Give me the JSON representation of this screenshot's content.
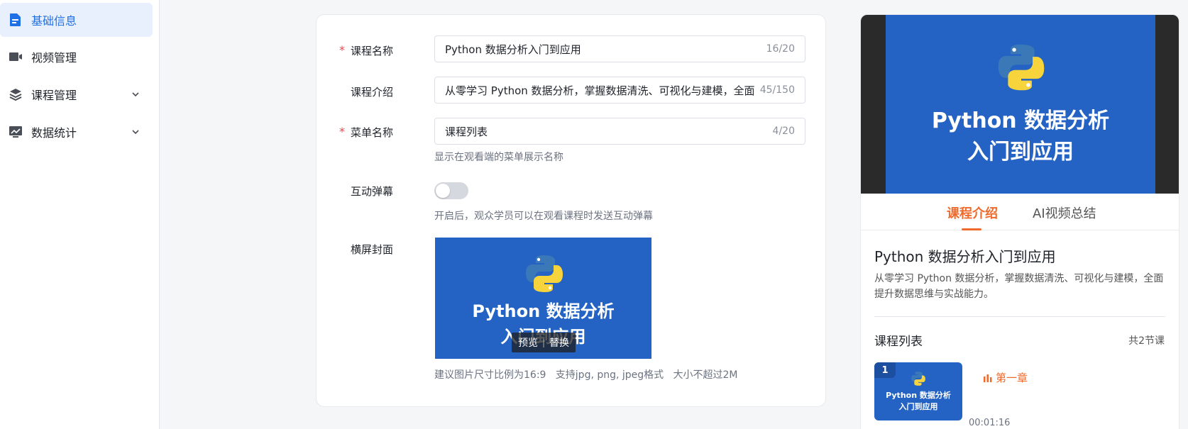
{
  "sidebar": {
    "items": [
      {
        "label": "基础信息",
        "icon": "document-icon",
        "active": true
      },
      {
        "label": "视频管理",
        "icon": "video-icon",
        "active": false
      },
      {
        "label": "课程管理",
        "icon": "layers-icon",
        "active": false
      },
      {
        "label": "数据统计",
        "icon": "chart-icon",
        "active": false
      }
    ]
  },
  "form": {
    "course_name": {
      "label": "课程名称",
      "value": "Python 数据分析入门到应用",
      "count": "16/20"
    },
    "course_intro": {
      "label": "课程介绍",
      "value": "从零学习 Python 数据分析，掌握数据清洗、可视化与建模，全面",
      "count": "45/150"
    },
    "menu_name": {
      "label": "菜单名称",
      "value": "课程列表",
      "count": "4/20",
      "hint": "显示在观看端的菜单展示名称"
    },
    "danmaku": {
      "label": "互动弹幕",
      "enabled": false,
      "hint": "开启后，观众学员可以在观看课程时发送互动弹幕"
    },
    "cover": {
      "label": "横屏封面",
      "title_line1": "Python 数据分析",
      "title_line2": "入门到应用",
      "preview_label": "预览",
      "replace_label": "替换",
      "hint": "建议图片尺寸比例为16:9   支持jpg, png, jpeg格式   大小不超过2M"
    }
  },
  "preview": {
    "video_title_line1": "Python 数据分析",
    "video_title_line2": "入门到应用",
    "tabs": [
      "课程介绍",
      "AI视频总结"
    ],
    "title": "Python 数据分析入门到应用",
    "description": "从零学习 Python 数据分析，掌握数据清洗、可视化与建模，全面提升数据思维与实战能力。",
    "list_title": "课程列表",
    "list_count": "共2节课",
    "lessons": [
      {
        "index": "1",
        "thumb_line1": "Python 数据分析",
        "thumb_line2": "入门到应用",
        "name": "第一章",
        "time": "00:01:16"
      }
    ]
  },
  "colors": {
    "accent_blue": "#1f6fe5",
    "accent_orange": "#ef6a2c",
    "cover_blue": "#2463c4",
    "required_red": "#e5484d"
  }
}
